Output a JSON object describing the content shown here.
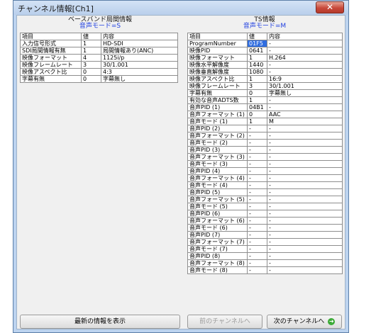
{
  "window": {
    "title": "チャンネル情報[Ch1]",
    "close_symbol": "✕"
  },
  "left_panel": {
    "title": "ベースバンド局間情報",
    "subtitle": "音声モード=S",
    "columns": [
      "項目",
      "値",
      "内容"
    ],
    "rows": [
      [
        "入力信号形式",
        "1",
        "HD-SDI"
      ],
      [
        "SDI局間情報有無",
        "1",
        "局間情報あり(ANC)"
      ],
      [
        "映像フォーマット",
        "4",
        "1125i/p"
      ],
      [
        "映像フレームレート",
        "3",
        "30/1.001"
      ],
      [
        "映像アスペクト比",
        "0",
        "4:3"
      ],
      [
        "字幕有無",
        "0",
        "字幕無し"
      ]
    ]
  },
  "right_panel": {
    "title": "TS情報",
    "subtitle": "音声モード=M",
    "columns": [
      "項目",
      "値",
      "内容"
    ],
    "rows": [
      [
        "ProgramNumber",
        "01F5",
        "-"
      ],
      [
        "映像PID",
        "0641",
        "-"
      ],
      [
        "映像フォーマット",
        "1",
        "H.264"
      ],
      [
        "映像水平解像度",
        "1440",
        "-"
      ],
      [
        "映像垂直解像度",
        "1080",
        "-"
      ],
      [
        "映像アスペクト比",
        "1",
        "16:9"
      ],
      [
        "映像フレームレート",
        "3",
        "30/1.001"
      ],
      [
        "字幕有無",
        "0",
        "字幕無し"
      ],
      [
        "有効な音声ADTS数",
        "1",
        "-"
      ],
      [
        "音声PID (1)",
        "04B1",
        "-"
      ],
      [
        "音声フォーマット (1)",
        "0",
        "AAC"
      ],
      [
        "音声モード (1)",
        "1",
        "M"
      ],
      [
        "音声PID (2)",
        "-",
        "-"
      ],
      [
        "音声フォーマット (2)",
        "-",
        "-"
      ],
      [
        "音声モード (2)",
        "-",
        "-"
      ],
      [
        "音声PID (3)",
        "-",
        "-"
      ],
      [
        "音声フォーマット (3)",
        "-",
        "-"
      ],
      [
        "音声モード (3)",
        "-",
        "-"
      ],
      [
        "音声PID (4)",
        "-",
        "-"
      ],
      [
        "音声フォーマット (4)",
        "-",
        "-"
      ],
      [
        "音声モード (4)",
        "-",
        "-"
      ],
      [
        "音声PID (5)",
        "-",
        "-"
      ],
      [
        "音声フォーマット (5)",
        "-",
        "-"
      ],
      [
        "音声モード (5)",
        "-",
        "-"
      ],
      [
        "音声PID (6)",
        "-",
        "-"
      ],
      [
        "音声フォーマット (6)",
        "-",
        "-"
      ],
      [
        "音声モード (6)",
        "-",
        "-"
      ],
      [
        "音声PID (7)",
        "-",
        "-"
      ],
      [
        "音声フォーマット (7)",
        "-",
        "-"
      ],
      [
        "音声モード (7)",
        "-",
        "-"
      ],
      [
        "音声PID (8)",
        "-",
        "-"
      ],
      [
        "音声フォーマット (8)",
        "-",
        "-"
      ],
      [
        "音声モード (8)",
        "-",
        "-"
      ]
    ]
  },
  "buttons": {
    "refresh": "最新の情報を表示",
    "prev_channel": "前のチャンネルへ",
    "next_channel": "次のチャンネルへ"
  },
  "icons": {
    "next_icon": "go-forward-icon",
    "next_icon_color": "#3aaa35",
    "selection_color": "#2f6de0"
  }
}
